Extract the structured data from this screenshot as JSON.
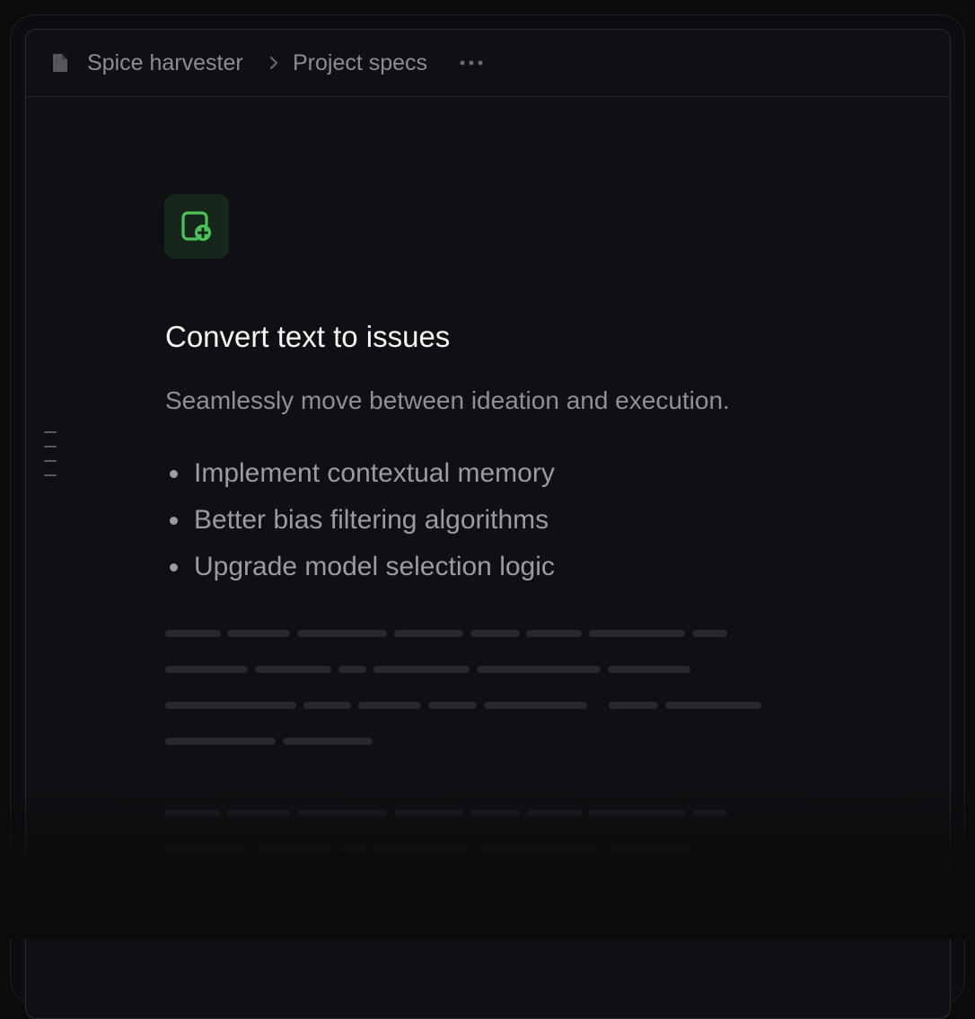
{
  "breadcrumb": {
    "items": [
      "Spice harvester",
      "Project specs"
    ],
    "doc_icon": "document-icon",
    "separator_icon": "chevron-right-icon",
    "more_icon": "more-horizontal-icon"
  },
  "feature": {
    "icon": "add-issue-icon",
    "accent": "#4cc35a",
    "title": "Convert text to issues",
    "subtitle": "Seamlessly move between ideation and execution.",
    "bullets": [
      "Implement contextual memory",
      "Better bias filtering algorithms",
      "Upgrade model selection logic"
    ]
  },
  "colors": {
    "background": "#0a0b0d",
    "panel": "#0f1013",
    "border": "#2a2c31",
    "text_primary": "#f4f5f7",
    "text_secondary": "#8e9096",
    "placeholder": "#26282c"
  }
}
